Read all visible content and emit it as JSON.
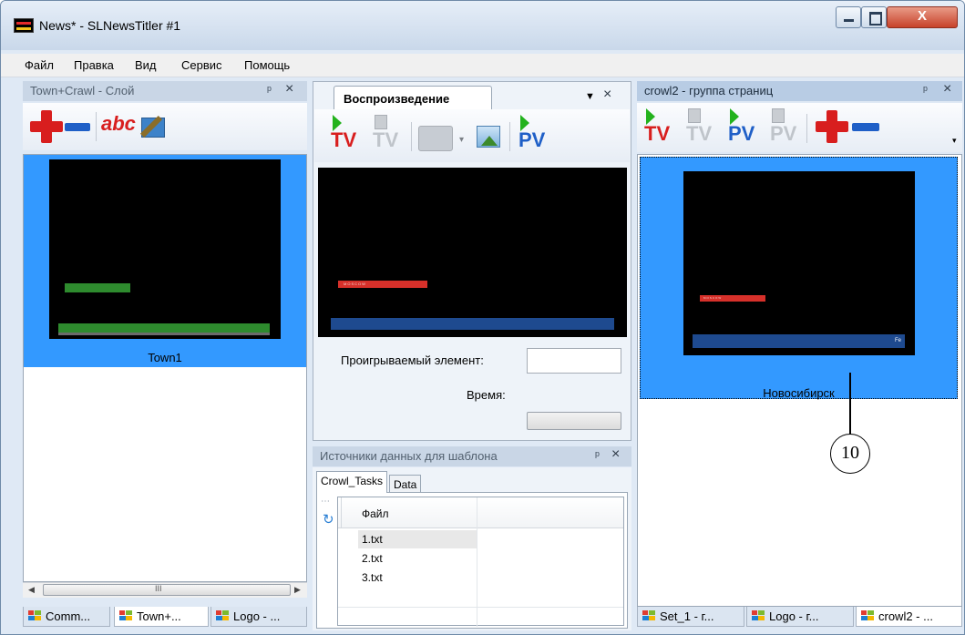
{
  "window": {
    "title": "News* - SLNewsTitler #1",
    "close_glyph": "X"
  },
  "menu": [
    "Файл",
    "Правка",
    "Вид",
    "Сервис",
    "Помощь"
  ],
  "left_panel": {
    "title": "Town+Crawl - Слой",
    "abc_label": "abc",
    "item_caption": "Town1",
    "scroll_glyph": "III"
  },
  "center_panel": {
    "tab": "Воспроизведение",
    "tv_label": "TV",
    "pv_label": "PV",
    "preview_text": "MOSCOW",
    "playing_label": "Проигрываемый элемент:",
    "playing_value": "",
    "time_label": "Время:"
  },
  "datasource_panel": {
    "title": "Источники данных для шаблона",
    "tabs": [
      "Crowl_Tasks",
      "Data"
    ],
    "column_header": "Файл",
    "rows": [
      "1.txt",
      "2.txt",
      "3.txt"
    ]
  },
  "right_panel": {
    "title": "crowl2 - группа страниц",
    "tv_label": "TV",
    "pv_label": "PV",
    "thumb_text": "MOSCOW",
    "thumb_corner": "Fe",
    "item_caption": "Новосибирск"
  },
  "bottom_tabs_left": [
    "Comm...",
    "Town+...",
    "Logo - ..."
  ],
  "bottom_tabs_right": [
    "Set_1 - г...",
    "Logo - г...",
    "crowl2 - ..."
  ],
  "callout": "10",
  "colors": {
    "selection": "#3399ff",
    "green_bar": "#2e8b2e",
    "red_bar": "#d6302a",
    "blue_bar": "#1e4a8f"
  }
}
